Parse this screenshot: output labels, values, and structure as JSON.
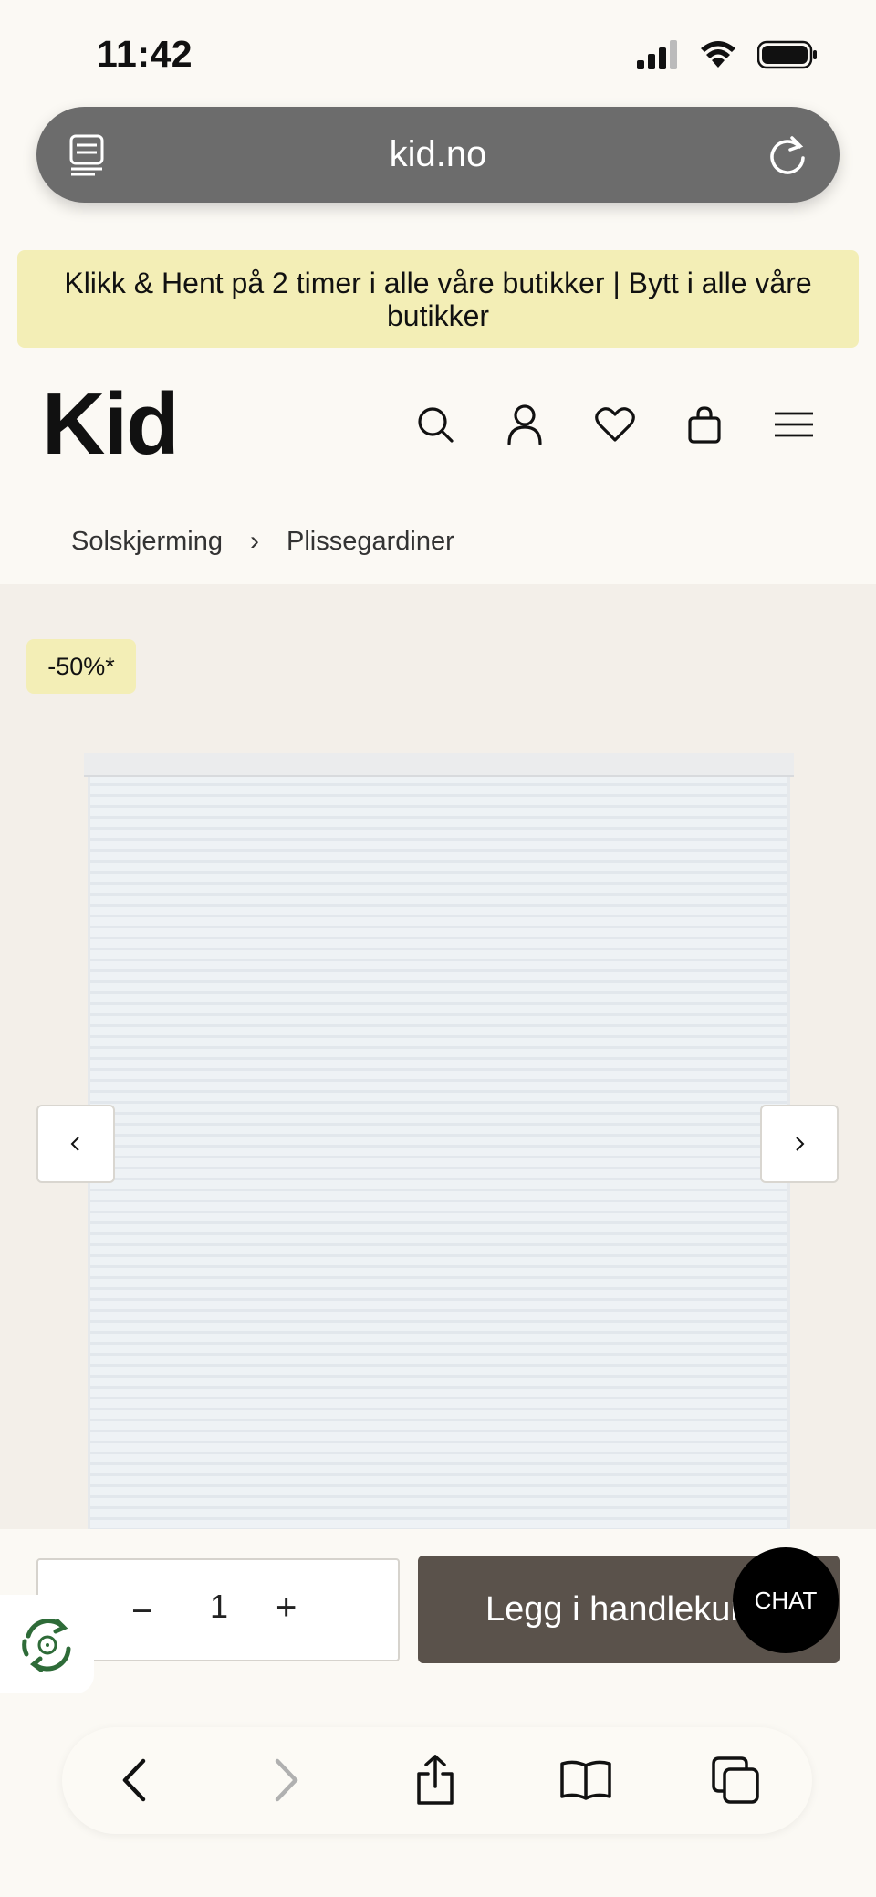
{
  "status_bar": {
    "time": "11:42",
    "icons": [
      "cellular-signal-icon",
      "wifi-icon",
      "battery-icon"
    ]
  },
  "browser": {
    "url": "kid.no",
    "reader_icon": "reader-mode-icon",
    "reload_icon": "reload-icon"
  },
  "promo": {
    "text": "Klikk & Hent på 2 timer i alle våre butikker | Bytt i alle våre butikker",
    "color": "#f3eeb6"
  },
  "header": {
    "logo": "Kid",
    "icons": [
      "search-icon",
      "account-icon",
      "heart-icon",
      "shopping-bag-icon",
      "menu-icon"
    ]
  },
  "breadcrumb": {
    "items": [
      "Solskjerming",
      "Plissegardiner"
    ]
  },
  "product": {
    "discount_badge": "-50%*",
    "prev_icon": "chevron-left-icon",
    "next_icon": "chevron-right-icon"
  },
  "cart": {
    "minus": "−",
    "quantity": "1",
    "plus": "+",
    "add_label": "Legg i handlekurv",
    "button_color": "#5a524b"
  },
  "chat": {
    "label": "CHAT"
  },
  "toolbar": {
    "icons": [
      "back-icon",
      "forward-icon",
      "share-icon",
      "bookmarks-icon",
      "tabs-icon"
    ]
  }
}
